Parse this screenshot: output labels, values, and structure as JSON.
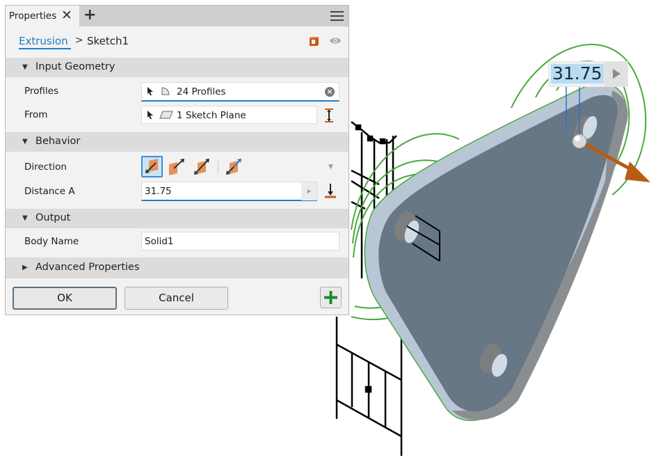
{
  "panel": {
    "tab_label": "Properties",
    "tab_close_icon": "close-icon",
    "tab_add_icon": "plus-icon",
    "menu_icon": "hamburger-menu-icon",
    "breadcrumb": {
      "link": "Extrusion",
      "separator": ">",
      "current": "Sketch1"
    },
    "sections": {
      "input_geometry": {
        "title": "Input Geometry",
        "expanded": true,
        "rows": {
          "profiles": {
            "label": "Profiles",
            "value": "24 Profiles"
          },
          "from": {
            "label": "From",
            "value": "1 Sketch Plane"
          }
        }
      },
      "behavior": {
        "title": "Behavior",
        "expanded": true,
        "rows": {
          "direction": {
            "label": "Direction",
            "options": [
              "default-direction",
              "flipped-direction",
              "symmetric-direction",
              "asymmetric-direction"
            ],
            "selected": "default-direction"
          },
          "distance_a": {
            "label": "Distance A",
            "value": "31.75"
          }
        }
      },
      "output": {
        "title": "Output",
        "expanded": true,
        "rows": {
          "body_name": {
            "label": "Body Name",
            "value": "Solid1"
          }
        }
      },
      "advanced": {
        "title": "Advanced Properties",
        "expanded": false
      }
    },
    "buttons": {
      "ok": "OK",
      "cancel": "Cancel"
    }
  },
  "viewport": {
    "dimension_value": "31.75",
    "colors": {
      "part_face": "#687785",
      "part_edge": "#b9c6d6",
      "sketch_curve": "#4aa83e",
      "manipulator_arrow": "#b85c14",
      "accent": "#1f7fc3",
      "orange_icon": "#d66a2a"
    }
  }
}
